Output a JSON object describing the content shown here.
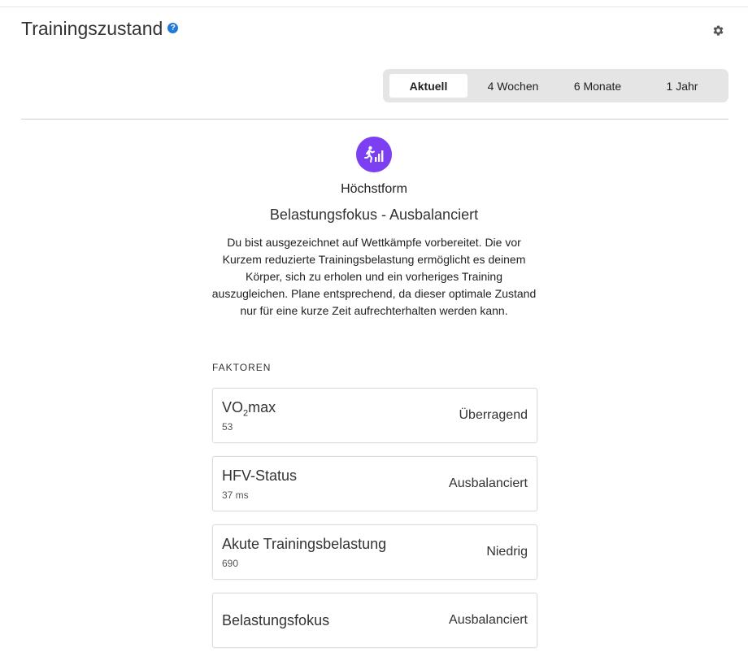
{
  "header": {
    "title": "Trainingszustand",
    "help_icon": "?",
    "icons": [
      "help-icon",
      "gear-icon"
    ]
  },
  "tabs": [
    {
      "label": "Aktuell",
      "active": true
    },
    {
      "label": "4 Wochen",
      "active": false
    },
    {
      "label": "6 Monate",
      "active": false
    },
    {
      "label": "1 Jahr",
      "active": false
    }
  ],
  "status": {
    "icon": "training-status-peak-icon",
    "title": "Höchstform",
    "subtitle": "Belastungsfokus - Ausbalanciert",
    "description": "Du bist ausgezeichnet auf Wettkämpfe vorbereitet. Die vor Kurzem reduzierte Trainingsbelastung ermöglicht es deinem Körper, sich zu erholen und ein vorheriges Training auszugleichen. Plane entsprechend, da dieser optimale Zustand nur für eine kurze Zeit aufrechterhalten werden kann."
  },
  "factors": {
    "label": "FAKTOREN",
    "items": [
      {
        "name_prefix": "VO",
        "name_sub": "2",
        "name_suffix": "max",
        "value": "53",
        "rating": "Überragend"
      },
      {
        "name": "HFV-Status",
        "value": "37 ms",
        "rating": "Ausbalanciert"
      },
      {
        "name": "Akute Trainingsbelastung",
        "value": "690",
        "rating": "Niedrig"
      },
      {
        "name": "Belastungsfokus",
        "rating": "Ausbalanciert"
      }
    ]
  },
  "colors": {
    "accent_purple": "#7c3ff2",
    "help_blue": "#1f7ad8",
    "segment_bg": "#e5e5e5"
  }
}
